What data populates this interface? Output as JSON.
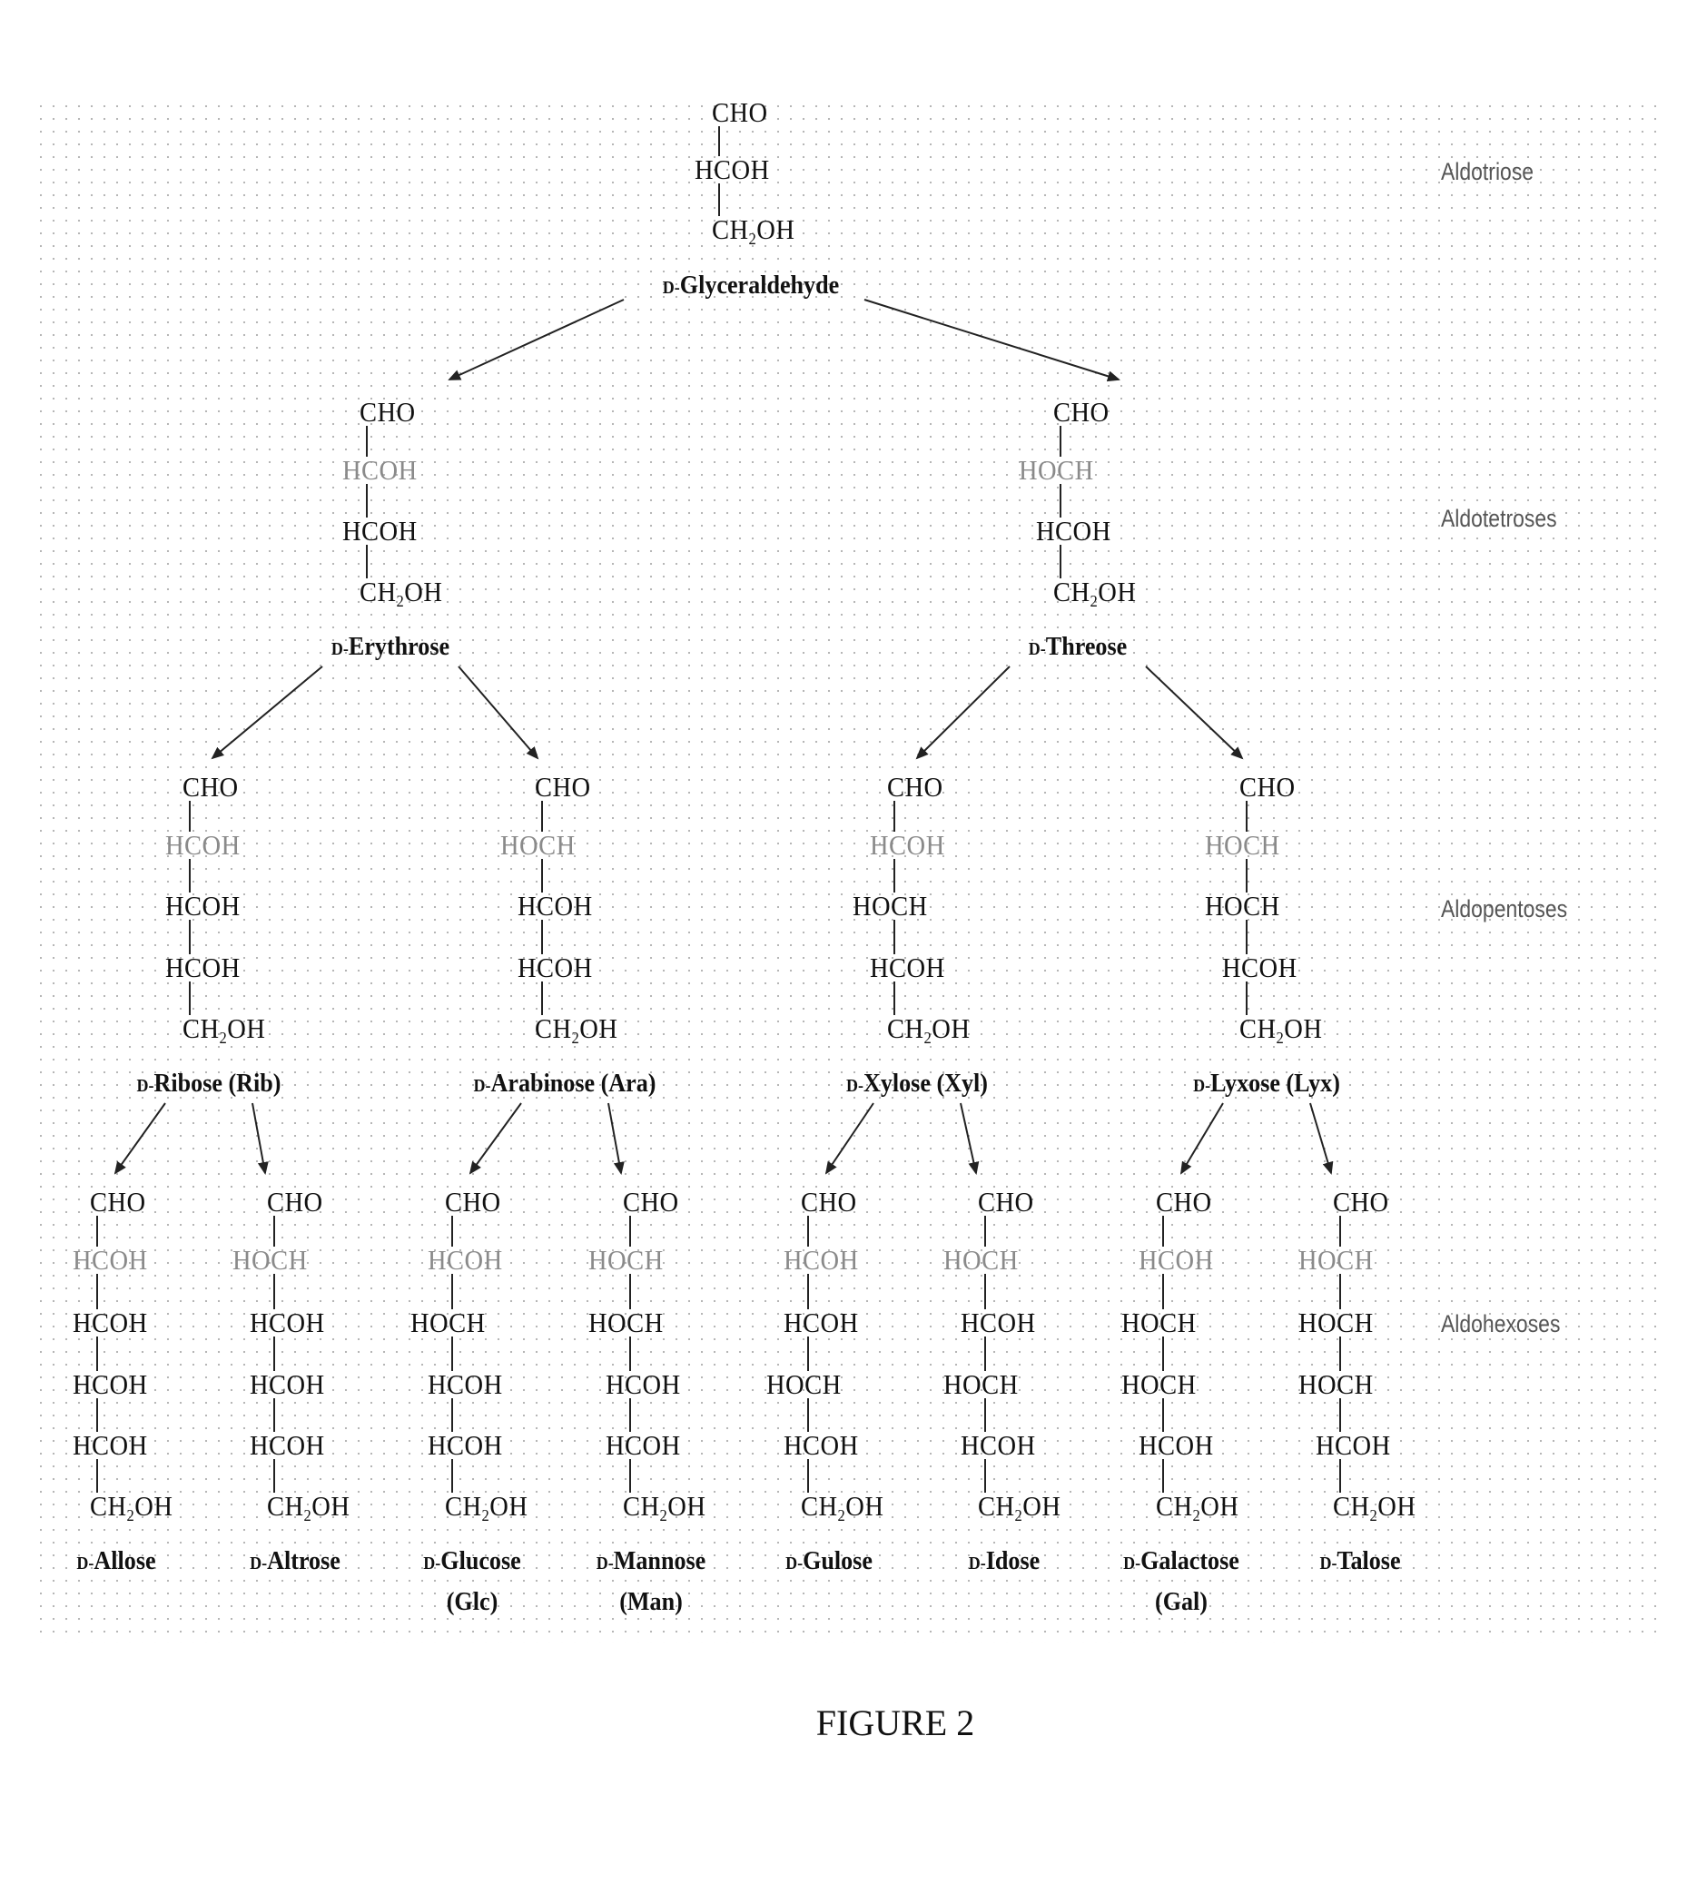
{
  "figure": {
    "caption": "FIGURE 2",
    "colors": {
      "text": "#111111",
      "new_stereocenter": "#8a8a8a",
      "category_label": "#555555",
      "arrow": "#222222"
    }
  },
  "categories": [
    {
      "id": "aldotriose",
      "label": "Aldotriose"
    },
    {
      "id": "aldotetroses",
      "label": "Aldotetroses"
    },
    {
      "id": "aldopentoses",
      "label": "Aldopentoses"
    },
    {
      "id": "aldohexoses",
      "label": "Aldohexoses"
    }
  ],
  "config_prefix": "D-",
  "sugars": [
    {
      "id": "glyceraldehyde",
      "level": 0,
      "name": "Glyceraldehyde",
      "abbr": "",
      "parent": null,
      "top": "CHO",
      "centers": [
        "HCOH"
      ],
      "bottom": "CH2OH"
    },
    {
      "id": "erythrose",
      "level": 1,
      "name": "Erythrose",
      "abbr": "",
      "parent": "glyceraldehyde",
      "top": "CHO",
      "centers": [
        "HCOH",
        "HCOH"
      ],
      "bottom": "CH2OH"
    },
    {
      "id": "threose",
      "level": 1,
      "name": "Threose",
      "abbr": "",
      "parent": "glyceraldehyde",
      "top": "CHO",
      "centers": [
        "HOCH",
        "HCOH"
      ],
      "bottom": "CH2OH"
    },
    {
      "id": "ribose",
      "level": 2,
      "name": "Ribose",
      "abbr": "(Rib)",
      "parent": "erythrose",
      "top": "CHO",
      "centers": [
        "HCOH",
        "HCOH",
        "HCOH"
      ],
      "bottom": "CH2OH"
    },
    {
      "id": "arabinose",
      "level": 2,
      "name": "Arabinose",
      "abbr": "(Ara)",
      "parent": "erythrose",
      "top": "CHO",
      "centers": [
        "HOCH",
        "HCOH",
        "HCOH"
      ],
      "bottom": "CH2OH"
    },
    {
      "id": "xylose",
      "level": 2,
      "name": "Xylose",
      "abbr": "(Xyl)",
      "parent": "threose",
      "top": "CHO",
      "centers": [
        "HCOH",
        "HOCH",
        "HCOH"
      ],
      "bottom": "CH2OH"
    },
    {
      "id": "lyxose",
      "level": 2,
      "name": "Lyxose",
      "abbr": "(Lyx)",
      "parent": "threose",
      "top": "CHO",
      "centers": [
        "HOCH",
        "HOCH",
        "HCOH"
      ],
      "bottom": "CH2OH"
    },
    {
      "id": "allose",
      "level": 3,
      "name": "Allose",
      "abbr": "",
      "parent": "ribose",
      "top": "CHO",
      "centers": [
        "HCOH",
        "HCOH",
        "HCOH",
        "HCOH"
      ],
      "bottom": "CH2OH"
    },
    {
      "id": "altrose",
      "level": 3,
      "name": "Altrose",
      "abbr": "",
      "parent": "ribose",
      "top": "CHO",
      "centers": [
        "HOCH",
        "HCOH",
        "HCOH",
        "HCOH"
      ],
      "bottom": "CH2OH"
    },
    {
      "id": "glucose",
      "level": 3,
      "name": "Glucose",
      "abbr": "(Glc)",
      "parent": "arabinose",
      "top": "CHO",
      "centers": [
        "HCOH",
        "HOCH",
        "HCOH",
        "HCOH"
      ],
      "bottom": "CH2OH"
    },
    {
      "id": "mannose",
      "level": 3,
      "name": "Mannose",
      "abbr": "(Man)",
      "parent": "arabinose",
      "top": "CHO",
      "centers": [
        "HOCH",
        "HOCH",
        "HCOH",
        "HCOH"
      ],
      "bottom": "CH2OH"
    },
    {
      "id": "gulose",
      "level": 3,
      "name": "Gulose",
      "abbr": "",
      "parent": "xylose",
      "top": "CHO",
      "centers": [
        "HCOH",
        "HCOH",
        "HOCH",
        "HCOH"
      ],
      "bottom": "CH2OH"
    },
    {
      "id": "idose",
      "level": 3,
      "name": "Idose",
      "abbr": "",
      "parent": "xylose",
      "top": "CHO",
      "centers": [
        "HOCH",
        "HCOH",
        "HOCH",
        "HCOH"
      ],
      "bottom": "CH2OH"
    },
    {
      "id": "galactose",
      "level": 3,
      "name": "Galactose",
      "abbr": "(Gal)",
      "parent": "lyxose",
      "top": "CHO",
      "centers": [
        "HCOH",
        "HOCH",
        "HOCH",
        "HCOH"
      ],
      "bottom": "CH2OH"
    },
    {
      "id": "talose",
      "level": 3,
      "name": "Talose",
      "abbr": "",
      "parent": "lyxose",
      "top": "CHO",
      "centers": [
        "HOCH",
        "HOCH",
        "HOCH",
        "HCOH"
      ],
      "bottom": "CH2OH"
    }
  ]
}
